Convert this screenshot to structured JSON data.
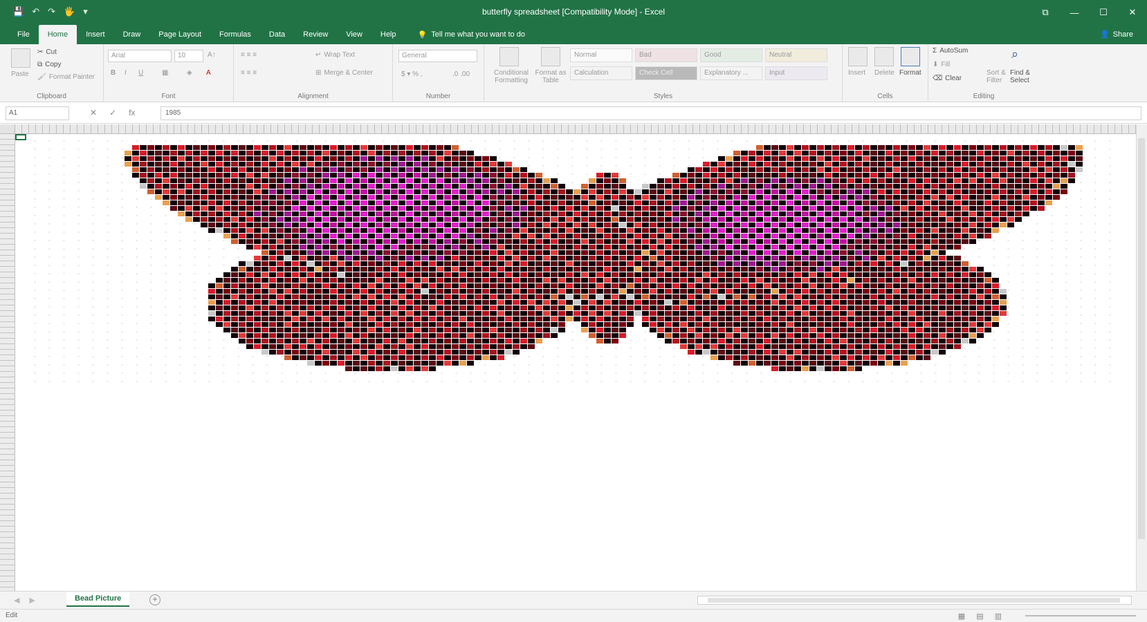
{
  "window": {
    "title": "butterfly spreadsheet [Compatibility Mode] - Excel",
    "share_label": "Share",
    "controls": [
      "⧉",
      "—",
      "☐",
      "✕"
    ]
  },
  "qat": [
    "💾",
    "↶",
    "↷",
    "🖐",
    "▾"
  ],
  "tabs": [
    "File",
    "Home",
    "Insert",
    "Draw",
    "Page Layout",
    "Formulas",
    "Data",
    "Review",
    "View",
    "Help"
  ],
  "tell_me": "Tell me what you want to do",
  "ribbon": {
    "clipboard": {
      "paste": "Paste",
      "cut": "Cut",
      "copy": "Copy",
      "format_painter": "Format Painter",
      "label": "Clipboard"
    },
    "font": {
      "name": "Arial",
      "size": "10",
      "label": "Font"
    },
    "alignment": {
      "wrap": "Wrap Text",
      "merge": "Merge & Center",
      "label": "Alignment"
    },
    "number": {
      "format": "General",
      "label": "Number"
    },
    "styles": {
      "conditional": "Conditional Formatting",
      "format_table": "Format as Table",
      "cells": [
        "Normal",
        "Bad",
        "Good",
        "Neutral",
        "Calculation",
        "Check Cell",
        "Explanatory ...",
        "Input"
      ],
      "label": "Styles"
    },
    "cells_group": {
      "insert": "Insert",
      "delete": "Delete",
      "format": "Format",
      "label": "Cells"
    },
    "editing": {
      "autosum": "AutoSum",
      "fill": "Fill",
      "clear": "Clear",
      "sort": "Sort & Filter",
      "find": "Find & Select",
      "label": "Editing"
    }
  },
  "formula_bar": {
    "name_box": "A1",
    "value": "1985"
  },
  "sheet": {
    "tab_name": "Bead Picture"
  },
  "status": {
    "mode": "Edit"
  },
  "colors": {
    "excel_green": "#217346"
  }
}
